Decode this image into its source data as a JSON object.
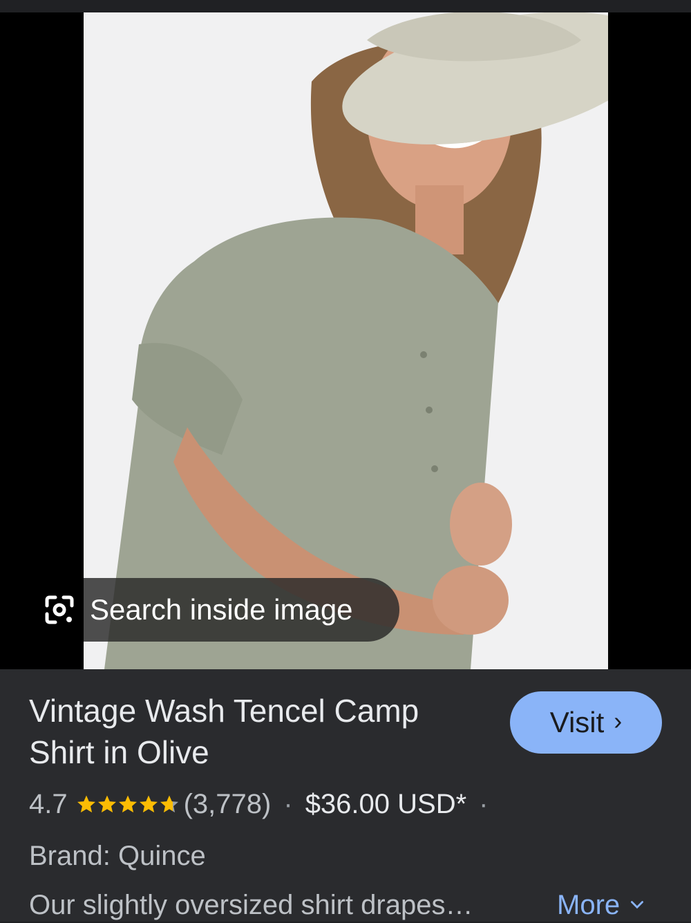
{
  "image": {
    "lens_label": "Search inside image"
  },
  "product": {
    "title": "Vintage Wash Tencel Camp Shirt in Olive",
    "rating": "4.7",
    "rating_value": 4.7,
    "reviews": "(3,778)",
    "separator": "·",
    "price": "$36.00 USD*",
    "brand": "Brand: Quince",
    "description": "Our slightly oversized shirt drapes…"
  },
  "actions": {
    "visit_label": "Visit",
    "more_label": "More"
  },
  "colors": {
    "accent": "#8ab4f8",
    "star": "#fbbc04",
    "background": "#202124"
  }
}
